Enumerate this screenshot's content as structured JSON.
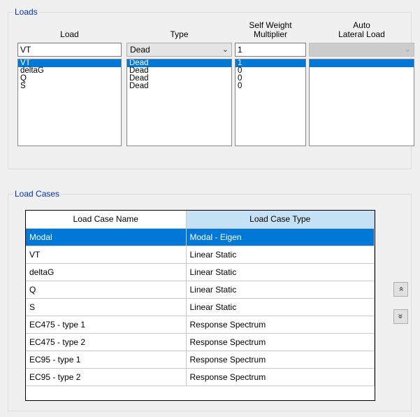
{
  "loads": {
    "group_title": "Loads",
    "headers": {
      "load": "Load",
      "type": "Type",
      "self_weight_line1": "Self Weight",
      "self_weight_line2": "Multiplier",
      "auto_line1": "Auto",
      "auto_line2": "Lateral Load"
    },
    "current": {
      "load": "VT",
      "type": "Dead",
      "self_weight": "1",
      "auto_lateral": ""
    },
    "rows": [
      {
        "load": "VT",
        "type": "Dead",
        "self_weight": "1",
        "auto": ""
      },
      {
        "load": "deltaG",
        "type": "Dead",
        "self_weight": "0",
        "auto": ""
      },
      {
        "load": "Q",
        "type": "Dead",
        "self_weight": "0",
        "auto": ""
      },
      {
        "load": "S",
        "type": "Dead",
        "self_weight": "0",
        "auto": ""
      }
    ],
    "selected_row": 0
  },
  "load_cases": {
    "group_title": "Load Cases",
    "columns": [
      "Load Case Name",
      "Load Case Type"
    ],
    "rows": [
      {
        "name": "Modal",
        "type": "Modal - Eigen"
      },
      {
        "name": "VT",
        "type": "Linear Static"
      },
      {
        "name": "deltaG",
        "type": "Linear Static"
      },
      {
        "name": "Q",
        "type": "Linear Static"
      },
      {
        "name": "S",
        "type": "Linear Static"
      },
      {
        "name": "EC475 - type 1",
        "type": "Response Spectrum"
      },
      {
        "name": "EC475 - type 2",
        "type": "Response Spectrum"
      },
      {
        "name": "EC95 - type 1",
        "type": "Response Spectrum"
      },
      {
        "name": "EC95 - type 2",
        "type": "Response Spectrum"
      }
    ],
    "selected_row": 0
  },
  "icons": {
    "move_up": "double-chevron-up-icon",
    "move_down": "double-chevron-down-icon",
    "dropdown": "chevron-down-icon"
  },
  "colors": {
    "selection": "#0078d7",
    "group_title": "#0033bc",
    "active_header": "#c5e1f5"
  }
}
